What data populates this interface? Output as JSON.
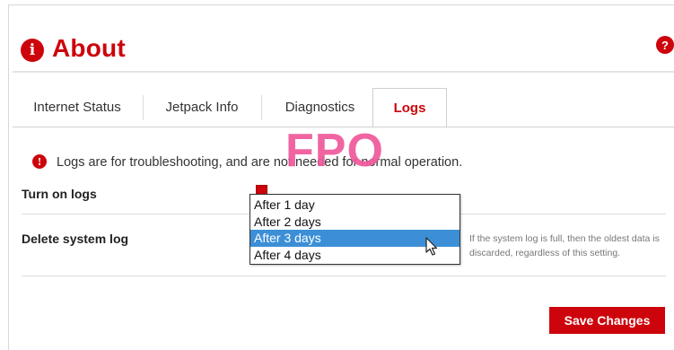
{
  "header": {
    "title": "About",
    "about_icon_glyph": "i",
    "help_icon_glyph": "?"
  },
  "tabs": [
    {
      "label": "Internet Status",
      "active": false
    },
    {
      "label": "Jetpack Info",
      "active": false
    },
    {
      "label": "Diagnostics",
      "active": false
    },
    {
      "label": "Logs",
      "active": true
    }
  ],
  "info": {
    "icon_glyph": "!",
    "text": "Logs are for troubleshooting, and are not needed for normal operation."
  },
  "overlay_text": "FPO",
  "settings": {
    "turn_on_logs": {
      "label": "Turn on logs",
      "checked": true
    },
    "delete_system_log": {
      "label": "Delete system log",
      "options": [
        "After 1 day",
        "After 2 days",
        "After 3 days",
        "After 4 days"
      ],
      "highlighted": "After 3 days",
      "hint": "If the system log is full, then the oldest data is discarded, regardless of this setting."
    }
  },
  "buttons": {
    "save": "Save Changes"
  },
  "colors": {
    "brand_red": "#cd040b",
    "highlight_blue": "#3c8fd6",
    "fpo_pink": "#ef5a9a"
  }
}
